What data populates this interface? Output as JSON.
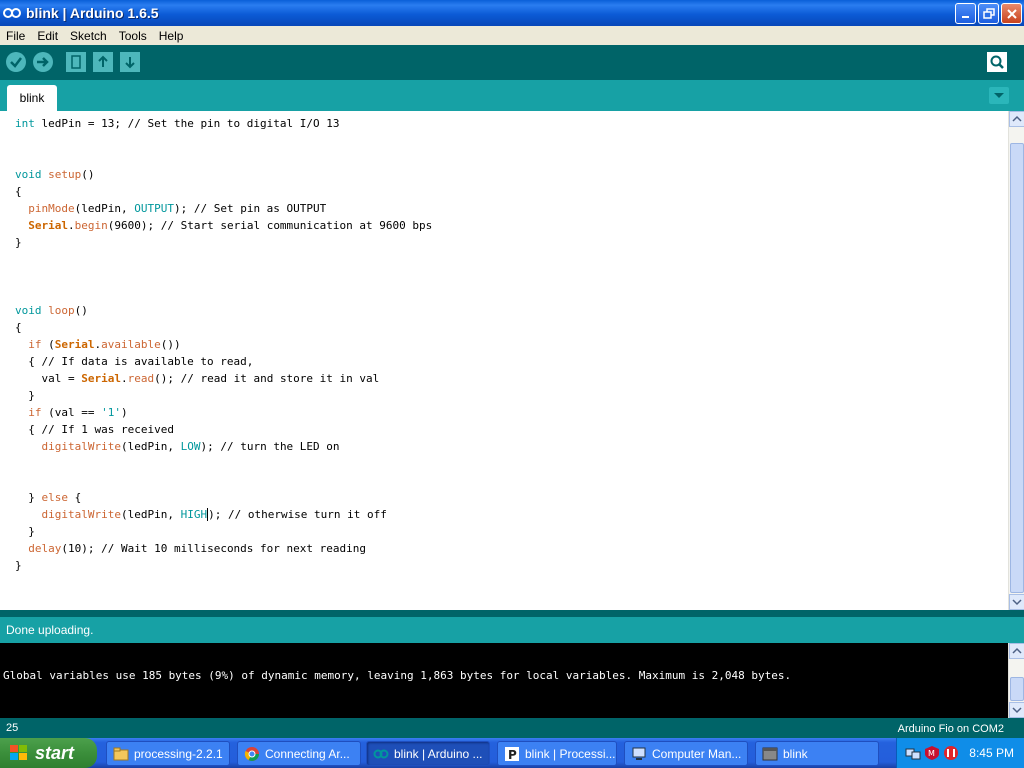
{
  "window": {
    "title": "blink | Arduino 1.6.5"
  },
  "menu": {
    "items": [
      "File",
      "Edit",
      "Sketch",
      "Tools",
      "Help"
    ]
  },
  "tabs": {
    "active": "blink"
  },
  "editor": {
    "lines": [
      [
        {
          "t": "int",
          "c": "type"
        },
        {
          "t": " ledPin = 13; // Set the pin to digital I/O 13"
        }
      ],
      [],
      [],
      [
        {
          "t": "void",
          "c": "type"
        },
        {
          "t": " "
        },
        {
          "t": "setup",
          "c": "kw"
        },
        {
          "t": "()"
        }
      ],
      [
        {
          "t": "{"
        }
      ],
      [
        {
          "t": "  "
        },
        {
          "t": "pinMode",
          "c": "kw"
        },
        {
          "t": "(ledPin, "
        },
        {
          "t": "OUTPUT",
          "c": "const"
        },
        {
          "t": "); // Set pin as OUTPUT"
        }
      ],
      [
        {
          "t": "  "
        },
        {
          "t": "Serial",
          "c": "ser"
        },
        {
          "t": "."
        },
        {
          "t": "begin",
          "c": "kw"
        },
        {
          "t": "(9600); // Start serial communication at 9600 bps"
        }
      ],
      [
        {
          "t": "}"
        }
      ],
      [],
      [],
      [],
      [
        {
          "t": "void",
          "c": "type"
        },
        {
          "t": " "
        },
        {
          "t": "loop",
          "c": "kw"
        },
        {
          "t": "()"
        }
      ],
      [
        {
          "t": "{"
        }
      ],
      [
        {
          "t": "  "
        },
        {
          "t": "if",
          "c": "kw"
        },
        {
          "t": " ("
        },
        {
          "t": "Serial",
          "c": "ser"
        },
        {
          "t": "."
        },
        {
          "t": "available",
          "c": "kw"
        },
        {
          "t": "())"
        }
      ],
      [
        {
          "t": "  { // If data is available to read,"
        }
      ],
      [
        {
          "t": "    val = "
        },
        {
          "t": "Serial",
          "c": "ser"
        },
        {
          "t": "."
        },
        {
          "t": "read",
          "c": "kw"
        },
        {
          "t": "(); // read it and store it in val"
        }
      ],
      [
        {
          "t": "  }"
        }
      ],
      [
        {
          "t": "  "
        },
        {
          "t": "if",
          "c": "kw"
        },
        {
          "t": " (val == "
        },
        {
          "t": "'1'",
          "c": "const"
        },
        {
          "t": ")"
        }
      ],
      [
        {
          "t": "  { // If 1 was received"
        }
      ],
      [
        {
          "t": "    "
        },
        {
          "t": "digitalWrite",
          "c": "kw"
        },
        {
          "t": "(ledPin, "
        },
        {
          "t": "LOW",
          "c": "const"
        },
        {
          "t": "); // turn the LED on"
        }
      ],
      [],
      [],
      [
        {
          "t": "  } "
        },
        {
          "t": "else",
          "c": "kw"
        },
        {
          "t": " {"
        }
      ],
      [
        {
          "t": "    "
        },
        {
          "t": "digitalWrite",
          "c": "kw"
        },
        {
          "t": "(ledPin, "
        },
        {
          "t": "HIGH",
          "c": "const"
        },
        {
          "t": "); // otherwise turn it off"
        }
      ],
      [
        {
          "t": "  }"
        }
      ],
      [
        {
          "t": "  "
        },
        {
          "t": "delay",
          "c": "kw"
        },
        {
          "t": "(10); // Wait 10 milliseconds for next reading"
        }
      ],
      [
        {
          "t": "}"
        }
      ]
    ]
  },
  "status": {
    "message": "Done uploading."
  },
  "console": {
    "lines": [
      "Global variables use 185 bytes (9%) of dynamic memory, leaving 1,863 bytes for local variables. Maximum is 2,048 bytes."
    ]
  },
  "footer": {
    "line_number": "25",
    "board": "Arduino Fio on COM2"
  },
  "taskbar": {
    "start_label": "start",
    "tasks": [
      {
        "label": "processing-2.2.1",
        "icon": "folder-icon"
      },
      {
        "label": "Connecting Ar...",
        "icon": "chrome-icon"
      },
      {
        "label": "blink | Arduino ...",
        "icon": "arduino-icon"
      },
      {
        "label": "blink | Processi...",
        "icon": "processing-icon"
      },
      {
        "label": "Computer Man...",
        "icon": "computer-icon"
      },
      {
        "label": "blink",
        "icon": "window-icon"
      }
    ],
    "clock": "8:45 PM"
  }
}
